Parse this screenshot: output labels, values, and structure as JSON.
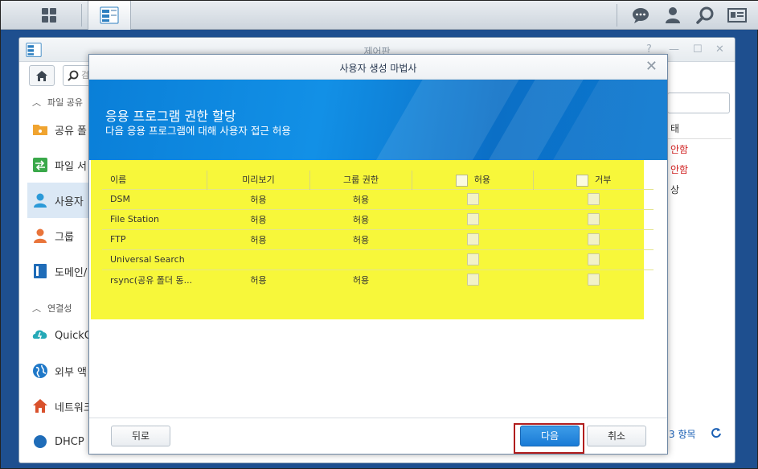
{
  "taskbar": {
    "icons": [
      "grid-icon",
      "control-panel-icon",
      "chat-icon",
      "user-icon",
      "search-icon",
      "id-card-icon"
    ]
  },
  "control_panel": {
    "title": "제어판",
    "search_placeholder": "검",
    "sidebar": {
      "section1": "파일 공유",
      "items": [
        {
          "label": "공유 폴",
          "icon": "shared-folder-icon"
        },
        {
          "label": "파일 서",
          "icon": "file-services-icon"
        },
        {
          "label": "사용자",
          "icon": "user-icon"
        },
        {
          "label": "그룹",
          "icon": "group-icon"
        },
        {
          "label": "도메인/",
          "icon": "domain-icon"
        }
      ],
      "section2": "연결성",
      "items2": [
        {
          "label": "QuickC",
          "icon": "quickconnect-icon"
        },
        {
          "label": "외부 액",
          "icon": "external-access-icon"
        },
        {
          "label": "네트워크",
          "icon": "network-icon"
        },
        {
          "label": "DHCP",
          "icon": "dhcp-icon"
        }
      ]
    },
    "right_column": {
      "header": "태",
      "rows": [
        "안함",
        "안함",
        "상"
      ],
      "row_colors": [
        "#d02020",
        "#d02020",
        "#333333"
      ]
    },
    "footer_count": "3 항목"
  },
  "wizard": {
    "title": "사용자 생성 마법사",
    "heading": "응용 프로그램 권한 할당",
    "subheading": "다음 응용 프로그램에 대해 사용자 접근 허용",
    "columns": {
      "name": "이름",
      "preview": "미리보기",
      "group_perm": "그룹 권한",
      "allow": "허용",
      "deny": "거부"
    },
    "rows": [
      {
        "name": "DSM",
        "preview": "허용",
        "group": "허용"
      },
      {
        "name": "File Station",
        "preview": "허용",
        "group": "허용"
      },
      {
        "name": "FTP",
        "preview": "허용",
        "group": "허용"
      },
      {
        "name": "Universal Search",
        "preview": "",
        "group": ""
      },
      {
        "name": "rsync(공유 폴더 동...",
        "preview": "허용",
        "group": "허용"
      }
    ],
    "buttons": {
      "back": "뒤로",
      "next": "다음",
      "cancel": "취소"
    },
    "accent_color": "#1a7bd6",
    "highlight_color": "#f7f73a"
  }
}
